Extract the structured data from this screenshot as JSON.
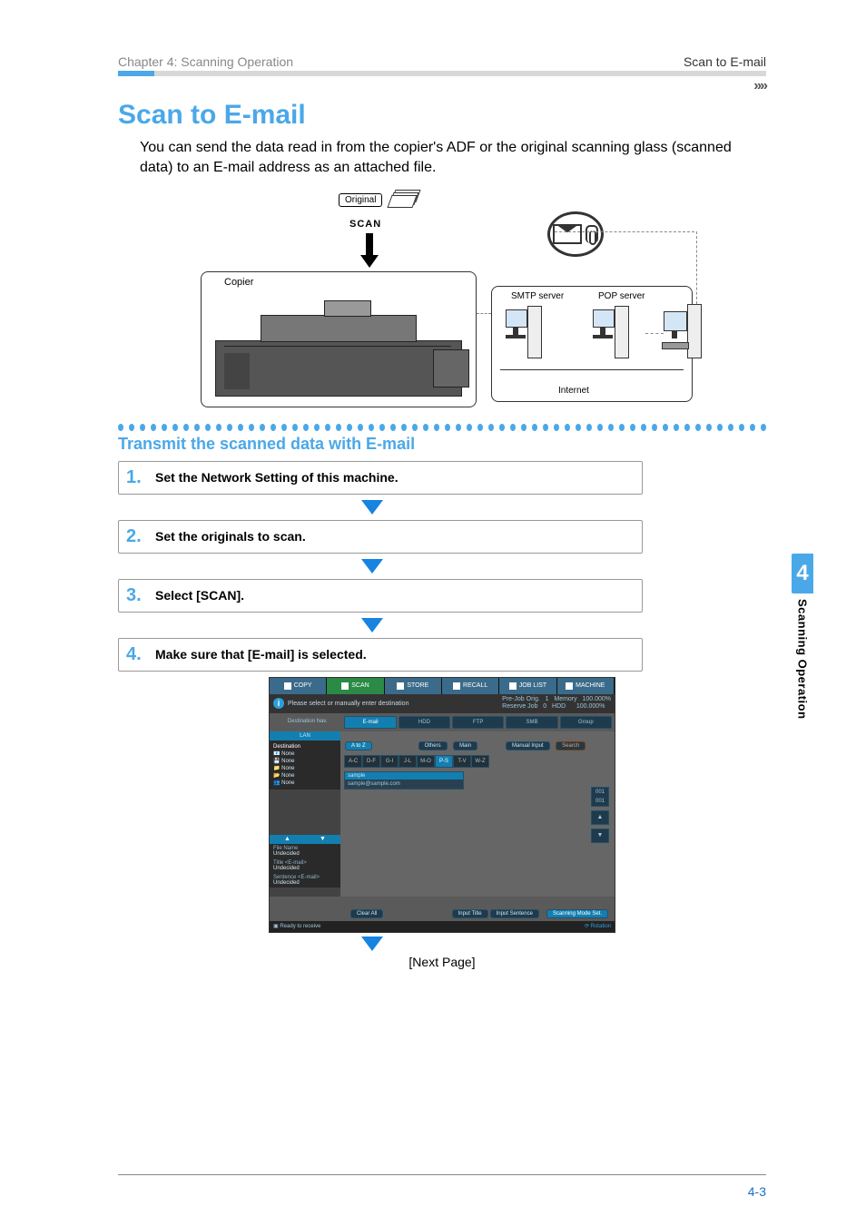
{
  "header": {
    "left": "Chapter 4: Scanning Operation",
    "right": "Scan to E-mail"
  },
  "title": "Scan to E-mail",
  "intro": "You can send the data read in from the copier's ADF or the original scanning glass (scanned data) to an E-mail address as an attached file.",
  "diagram": {
    "original_label": "Original",
    "scan_label": "SCAN",
    "copier_label": "Copier",
    "smtp_label": "SMTP server",
    "pop_label": "POP server",
    "internet_label": "Internet"
  },
  "subtitle": "Transmit the scanned data with E-mail",
  "steps": [
    {
      "num": "1.",
      "text": "Set the Network Setting of this machine."
    },
    {
      "num": "2.",
      "text": "Set the originals to scan."
    },
    {
      "num": "3.",
      "text": "Select [SCAN]."
    },
    {
      "num": "4.",
      "text": "Make sure that [E-mail] is selected."
    }
  ],
  "screenshot": {
    "top_tabs": [
      "COPY",
      "SCAN",
      "STORE",
      "RECALL",
      "JOB LIST",
      "MACHINE"
    ],
    "info_text": "Please select or manually enter destination",
    "status_right": "Pre-Job Orig.   1   Memory   100.000%\nReserve Job   0   HDD      100.000%",
    "sub_tabs": [
      "E-mail",
      "HDD",
      "FTP",
      "SMB",
      "Group"
    ],
    "destination_heading": "LAN",
    "destination_title": "Destination",
    "dest_items": [
      "None",
      "None",
      "None",
      "None",
      "None"
    ],
    "filter_btn": "A to Z",
    "others_btn": "Others",
    "main_btn": "Main",
    "manual_btn": "Manual Input",
    "search_btn": "Search",
    "alpha": [
      "A-C",
      "D-F",
      "G-I",
      "J-L",
      "M-O",
      "P-S",
      "T-V",
      "W-Z"
    ],
    "result_header": "sample",
    "result_body": "sample@sample.com",
    "side_dual": "001\n001",
    "side_up": "▲",
    "side_down": "▼",
    "meta": {
      "file_name_lbl": "File Name",
      "file_name_val": "Undecided",
      "title_lbl": "Title <E-mail>",
      "title_val": "Undecided",
      "sentence_lbl": "Sentence <E-mail>",
      "sentence_val": "Undecided"
    },
    "bottom_buttons": {
      "clear_all": "Clear All",
      "input_title": "Input Title",
      "input_sentence": "Input Sentence",
      "scan_mode": "Scanning Mode Set."
    },
    "status_bar_left": "Ready to receive",
    "status_bar_right": "Rotation"
  },
  "next_page": "[Next Page]",
  "side": {
    "chapter_num": "4",
    "chapter_text": "Scanning Operation"
  },
  "footer": "4-3"
}
